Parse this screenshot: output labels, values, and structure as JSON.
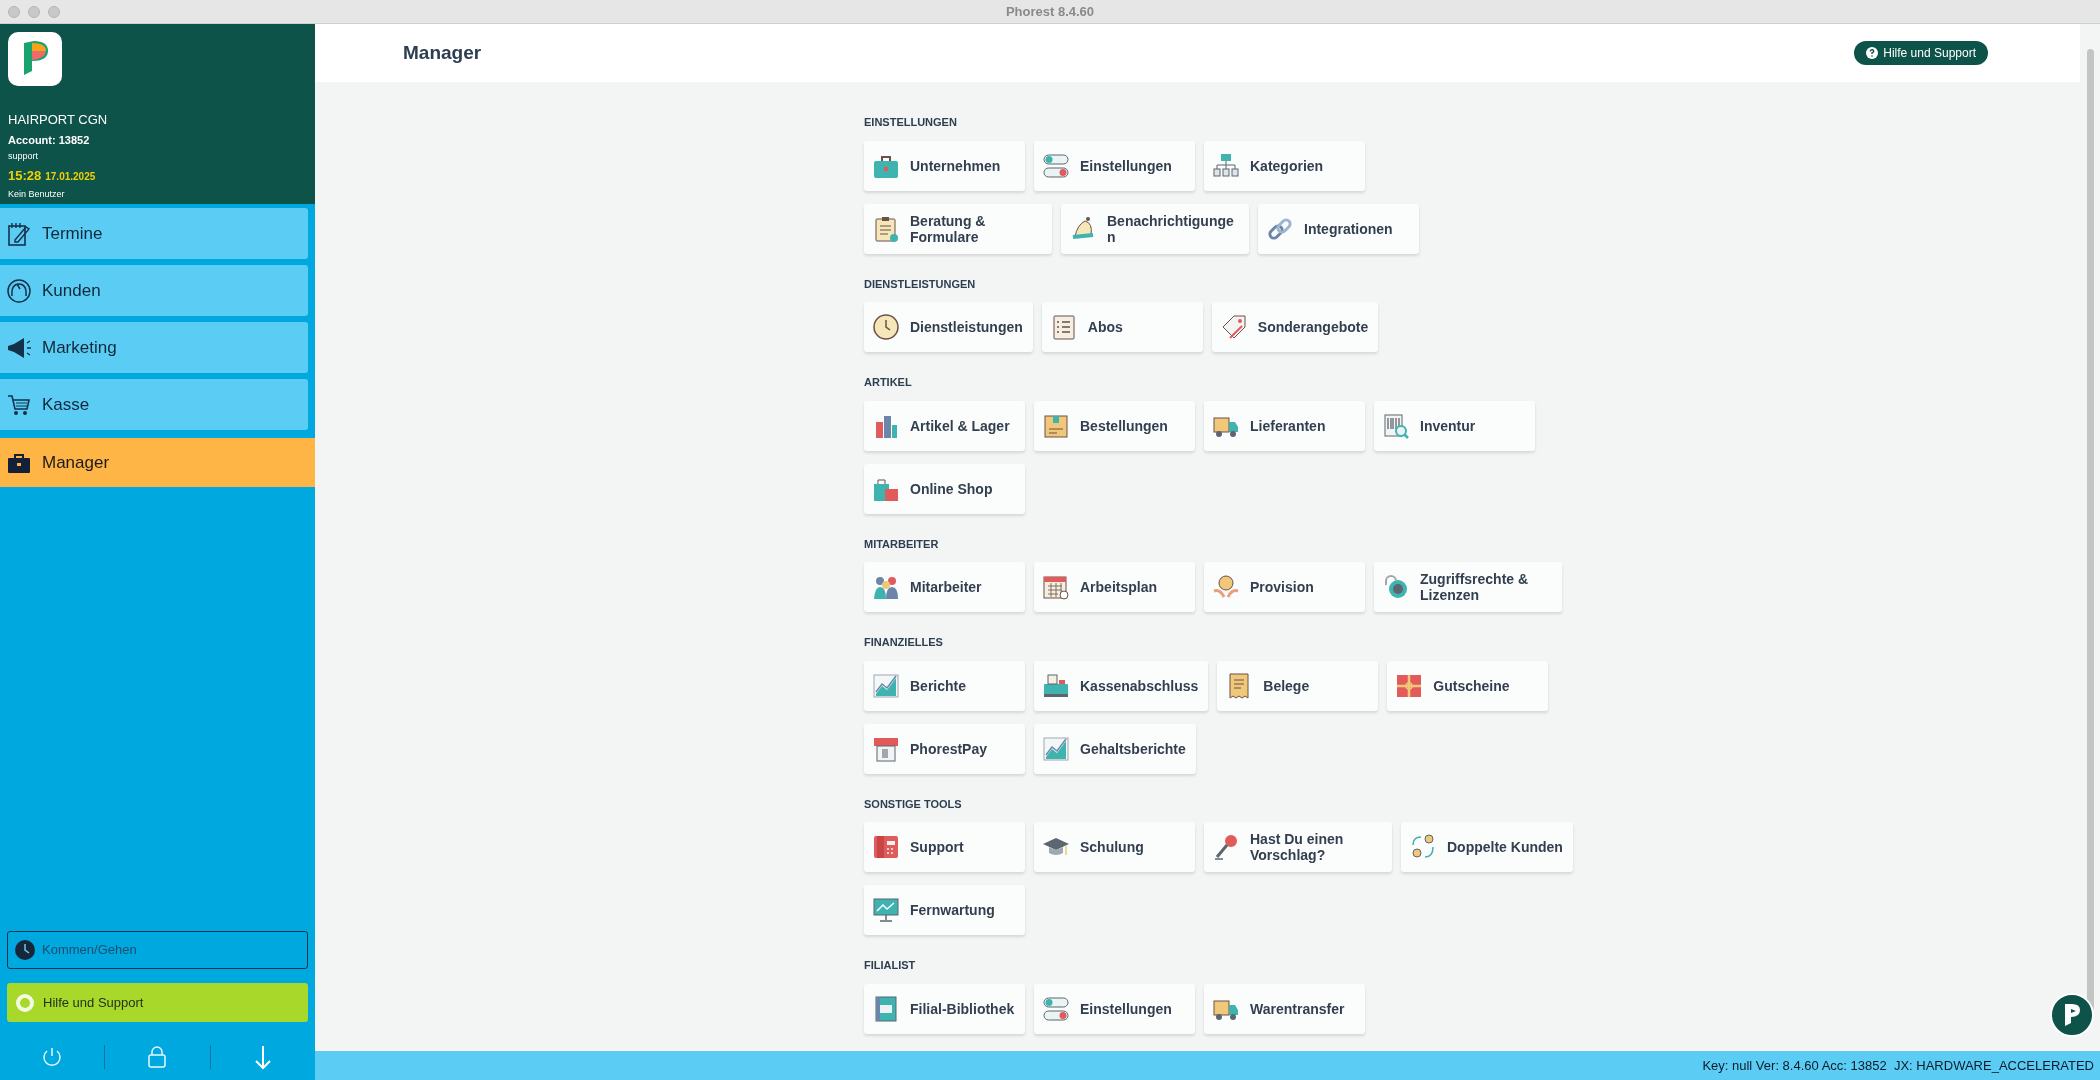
{
  "window": {
    "title": "Phorest 8.4.60"
  },
  "sidebar": {
    "salon": "HAIRPORT CGN",
    "account": "Account: 13852",
    "user": "support",
    "time": "15:28",
    "date": "17.01.2025",
    "staff": "Kein Benutzer",
    "nav": [
      {
        "label": "Termine",
        "selected": false
      },
      {
        "label": "Kunden",
        "selected": false
      },
      {
        "label": "Marketing",
        "selected": false
      },
      {
        "label": "Kasse",
        "selected": false
      },
      {
        "label": "Manager",
        "selected": true
      }
    ],
    "clock_button": "Kommen/Gehen",
    "help_button": "Hilfe und Support"
  },
  "header": {
    "title": "Manager",
    "help_button": "Hilfe und Support"
  },
  "sections": [
    {
      "title": "EINSTELLUNGEN",
      "rows": [
        [
          "Unternehmen",
          "Einstellungen",
          "Kategorien"
        ],
        [
          "Beratung & Formulare",
          "Benachrichtigungen",
          "Integrationen"
        ]
      ]
    },
    {
      "title": "DIENSTLEISTUNGEN",
      "rows": [
        [
          "Dienstleistungen",
          "Abos",
          "Sonderangebote"
        ]
      ]
    },
    {
      "title": "ARTIKEL",
      "rows": [
        [
          "Artikel & Lager",
          "Bestellungen",
          "Lieferanten",
          "Inventur"
        ],
        [
          "Online Shop"
        ]
      ]
    },
    {
      "title": "MITARBEITER",
      "rows": [
        [
          "Mitarbeiter",
          "Arbeitsplan",
          "Provision",
          "Zugriffsrechte & Lizenzen"
        ]
      ]
    },
    {
      "title": "FINANZIELLES",
      "rows": [
        [
          "Berichte",
          "Kassenabschluss",
          "Belege",
          "Gutscheine"
        ],
        [
          "PhorestPay",
          "Gehaltsberichte"
        ]
      ]
    },
    {
      "title": "SONSTIGE TOOLS",
      "rows": [
        [
          "Support",
          "Schulung",
          "Hast Du einen Vorschlag?",
          "Doppelte Kunden"
        ],
        [
          "Fernwartung"
        ]
      ]
    },
    {
      "title": "FILIALIST",
      "rows": [
        [
          "Filial-Bibliothek",
          "Einstellungen",
          "Warentransfer"
        ]
      ]
    }
  ],
  "status_bar": "Key: null Ver: 8.4.60 Acc: 13852  JX: HARDWARE_ACCELERATED"
}
